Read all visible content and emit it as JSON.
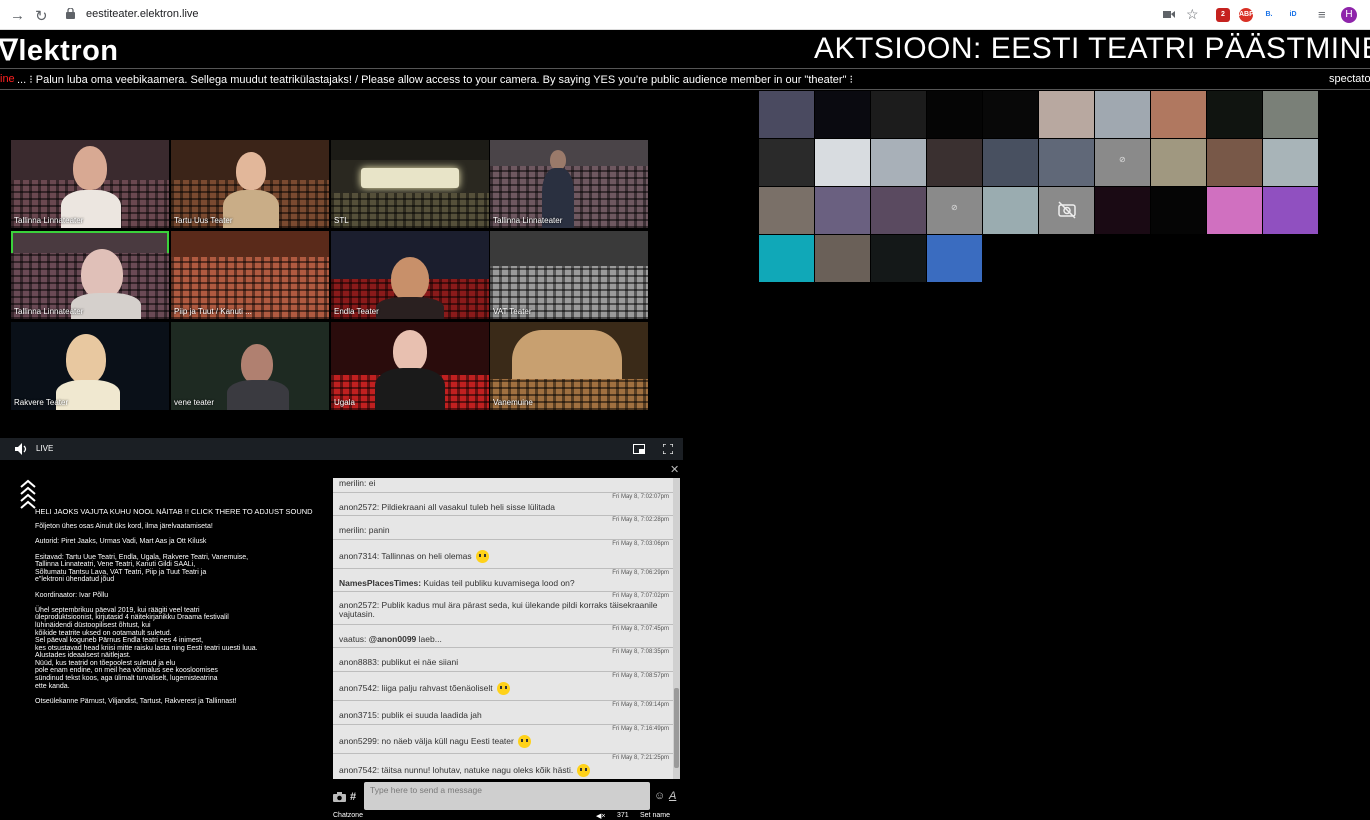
{
  "browser": {
    "url": "eestiteater.elektron.live",
    "profile_initial": "H",
    "ext_badge": "2",
    "ext_abp": "ABP",
    "ext_b": "B.",
    "ext_id": "iD"
  },
  "header": {
    "logo": "ᐁlektron",
    "title": "AKTSIOON: EESTI TEATRI PÄÄSTMINE"
  },
  "ticker": {
    "live_fragment": "ine",
    "message": "... ⁝ Palun luba oma veebikaamera. Sellega muudut teatrikülastajaks! / Please allow access to your camera. By saying YES you're public audience member in our \"theater\" ⁝",
    "spectators": "spectator"
  },
  "stage": {
    "tiles": [
      {
        "label": "Tallinna Linnateater"
      },
      {
        "label": "Tartu Uus Teater"
      },
      {
        "label": "STL"
      },
      {
        "label": "Tallinna Linnateater"
      },
      {
        "label": "Tallinna Linnateater"
      },
      {
        "label": "Piip ja Tuut / Kanuti ..."
      },
      {
        "label": "Endla Teater"
      },
      {
        "label": "VAT Teater"
      },
      {
        "label": "Rakvere Teater"
      },
      {
        "label": "vene teater"
      },
      {
        "label": "Ugala"
      },
      {
        "label": "Vanemuine"
      }
    ]
  },
  "player": {
    "live_label": "LIVE"
  },
  "info": {
    "heading": "HELI JAOKS VAJUTA KUHU NOOL NÄITAB !! CLICK THERE TO ADJUST SOUND",
    "p1": "Fõljeton ühes osas Ainult üks kord, ilma järelvaatamiseta!",
    "p2": "Autorid: Piret Jaaks, Urmas Vadi, Mart Aas ja Ott Kilusk",
    "p3a": "Esitavad: Tartu Uue Teatri, Endla, Ugala, Rakvere Teatri, Vanemuise,",
    "p3b": "Tallinna Linnateatri, Vene Teatri, Kanuti Gildi SAALi,",
    "p3c": "Sõltumatu Tantsu Lava, VAT Teatri, Piip ja Tuut Teatri ja",
    "p3d": "e\"lektroni ühendatud jõud",
    "p4": "Koordinaator: Ivar Põllu",
    "p5a": "Ühel septembrikuu päeval 2019, kui räägiti veel teatri",
    "p5b": "üleproduktsioonist, kirjutasid 4 näitekirjanikku Draama festivalil",
    "p5c": "lühinäidendi düstoopilisest õhtust, kui",
    "p5d": "kõikide teatrite uksed on ootamatult suletud.",
    "p5e": "Sel päeval koguneb Pärnus Endla teatri ees 4 inimest,",
    "p5f": "kes otsustavad head kriisi mitte raisku lasta ning Eesti teatri uuesti luua.",
    "p5g": "Alustades ideaalsest näitlejast.",
    "p5h": "Nüüd, kus teatrid on tõepoolest suletud ja elu",
    "p5i": "pole enam endine, on meil hea võimalus see koosloomises",
    "p5j": "sündinud tekst koos, aga ülimalt turvaliselt, lugemisteatrina",
    "p5k": "ette kanda.",
    "p6": "Otseülekanne Pärnust, Viljandist, Tartust, Rakverest ja Tallinnast!"
  },
  "chat": {
    "messages": [
      {
        "ts": "",
        "text": "merilin: ei"
      },
      {
        "ts": "Fri May 8, 7:02:07pm",
        "text": "anon2572: Pildiekraani all vasakul tuleb heli sisse lülitada"
      },
      {
        "ts": "Fri May 8, 7:02:28pm",
        "text": "merilin: panin"
      },
      {
        "ts": "Fri May 8, 7:03:06pm",
        "text": "anon7314: Tallinnas on heli olemas"
      },
      {
        "ts": "Fri May 8, 7:06:29pm",
        "author": "NamesPlacesTimes:",
        "text": " Kuidas teil publiku kuvamisega lood on?"
      },
      {
        "ts": "Fri May 8, 7:07:02pm",
        "text": "anon2572: Publik kadus mul ära pärast seda, kui ülekande pildi korraks täisekraanile vajutasin."
      },
      {
        "ts": "Fri May 8, 7:07:45pm",
        "text": "vaatus: ",
        "mention": "@anon0099",
        "tail": " laeb..."
      },
      {
        "ts": "Fri May 8, 7:08:35pm",
        "text": "anon8883: publikut ei näe siiani"
      },
      {
        "ts": "Fri May 8, 7:08:57pm",
        "text": "anon7542: liiga palju rahvast tõenäoliselt"
      },
      {
        "ts": "Fri May 8, 7:09:14pm",
        "text": "anon3715: publik ei suuda laadida jah"
      },
      {
        "ts": "Fri May 8, 7:16:49pm",
        "text": "anon5299: no näeb välja küll nagu Eesti teater"
      },
      {
        "ts": "Fri May 8, 7:21:25pm",
        "text": "anon7542: täitsa nunnu! lohutav, natuke nagu oleks kõik hästi."
      }
    ],
    "input_placeholder": "Type here to send a message",
    "hash_label": "#",
    "font_label": "A",
    "bottom_left": "Chatzone",
    "viewer_count": "371",
    "set_name": "Set name"
  }
}
